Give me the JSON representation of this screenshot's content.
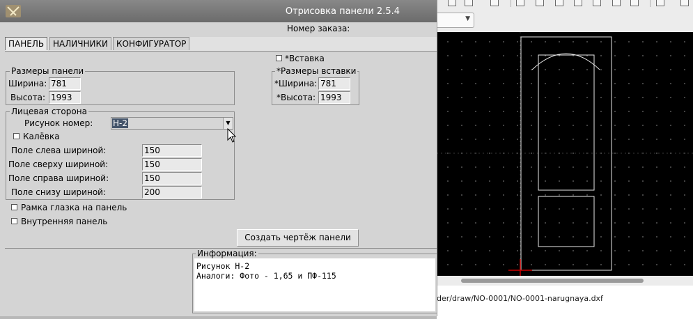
{
  "dialog": {
    "title": "Отрисовка панели 2.5.4",
    "order_label": "Номер заказа:",
    "tabs": [
      {
        "label": "ПАНЕЛЬ",
        "active": true
      },
      {
        "label": "НАЛИЧНИКИ",
        "active": false
      },
      {
        "label": "КОНФИГУРАТОР",
        "active": false
      }
    ],
    "panel_size": {
      "title": "Размеры панели",
      "width_label": "Ширина:",
      "width_value": "781",
      "height_label": "Высота:",
      "height_value": "1993"
    },
    "insert": {
      "checkbox_label": "*Вставка",
      "checked": false,
      "group_title": "*Размеры вставки",
      "width_label": "*Ширина:",
      "width_value": "781",
      "height_label": "*Высота:",
      "height_value": "1993"
    },
    "face_side": {
      "title": "Лицевая сторона",
      "pattern_label": "Рисунок номер:",
      "pattern_value": "Н-2",
      "kalevka_label": "Калёвка",
      "kalevka_checked": false,
      "fields": [
        {
          "label": "Поле слева шириной:",
          "value": "150"
        },
        {
          "label": "Поле сверху шириной:",
          "value": "150"
        },
        {
          "label": "Поле справа шириной:",
          "value": "150"
        },
        {
          "label": "Поле снизу шириной:",
          "value": "200"
        }
      ]
    },
    "options": {
      "peephole_frame_label": "Рамка глазка на панель",
      "peephole_frame_checked": false,
      "inner_panel_label": "Внутренняя панель",
      "inner_panel_checked": false
    },
    "create_button_label": "Создать чертёж панели",
    "info": {
      "title": "Информация:",
      "line1": "Рисунок Н-2",
      "line2": "Аналоги: Фото - 1,65 и ПФ-115"
    }
  },
  "background_app": {
    "status_path": "der/draw/NO-0001/NO-0001-narugnaya.dxf"
  },
  "colors": {
    "titlebar": "#6b6b6b",
    "selection": "#44546a",
    "canvas": "#000000",
    "drawing_lines": "#e8e8e8",
    "origin_marker": "#cc0000"
  }
}
